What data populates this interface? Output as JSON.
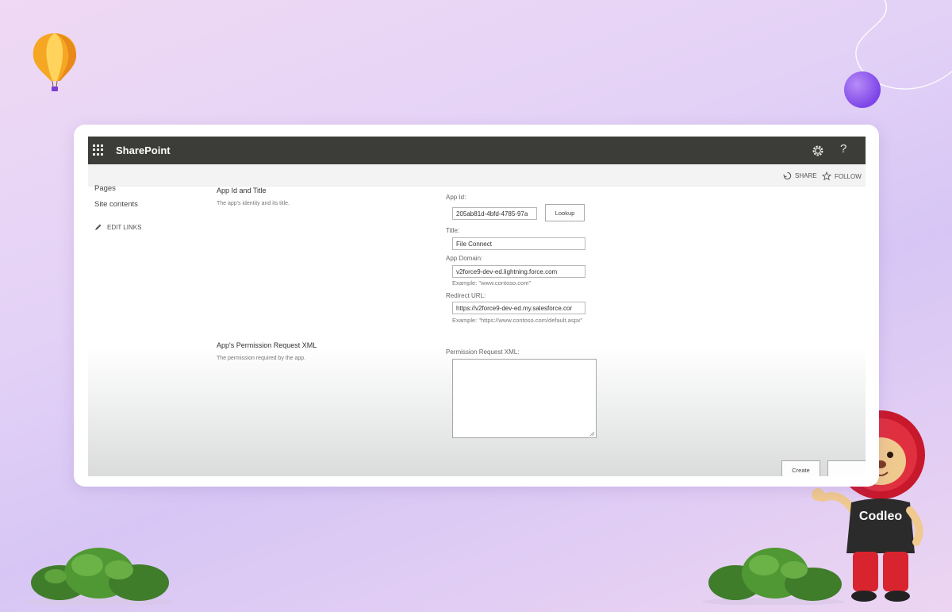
{
  "header": {
    "brand": "SharePoint",
    "help": "?"
  },
  "actions": {
    "share": "SHARE",
    "follow": "FOLLOW"
  },
  "nav": {
    "pages": "Pages",
    "site_contents": "Site contents",
    "edit_links": "EDIT LINKS"
  },
  "sections": {
    "app_id": {
      "title": "App Id and Title",
      "desc": "The app's identity and its title."
    },
    "permission": {
      "title": "App's Permission Request XML",
      "desc": "The permission required by the app."
    }
  },
  "form": {
    "app_id_label": "App Id:",
    "app_id_value": "205ab81d-4bfd-4785-97a",
    "lookup": "Lookup",
    "title_label": "Title:",
    "title_value": "File Connect",
    "domain_label": "App Domain:",
    "domain_value": "v2force9-dev-ed.lightning.force.com",
    "domain_hint": "Example: \"www.contoso.com\"",
    "redirect_label": "Redirect URL:",
    "redirect_value": "https://v2force9-dev-ed.my.salesforce.cor",
    "redirect_hint": "Example: \"https://www.contoso.com/default.aspx\"",
    "xml_label": "Permission Request XML:",
    "create": "Create"
  },
  "mascot_text": "Codleo",
  "colors": {
    "suitebar": "#3c3c38",
    "accent": "#7d45e8"
  }
}
